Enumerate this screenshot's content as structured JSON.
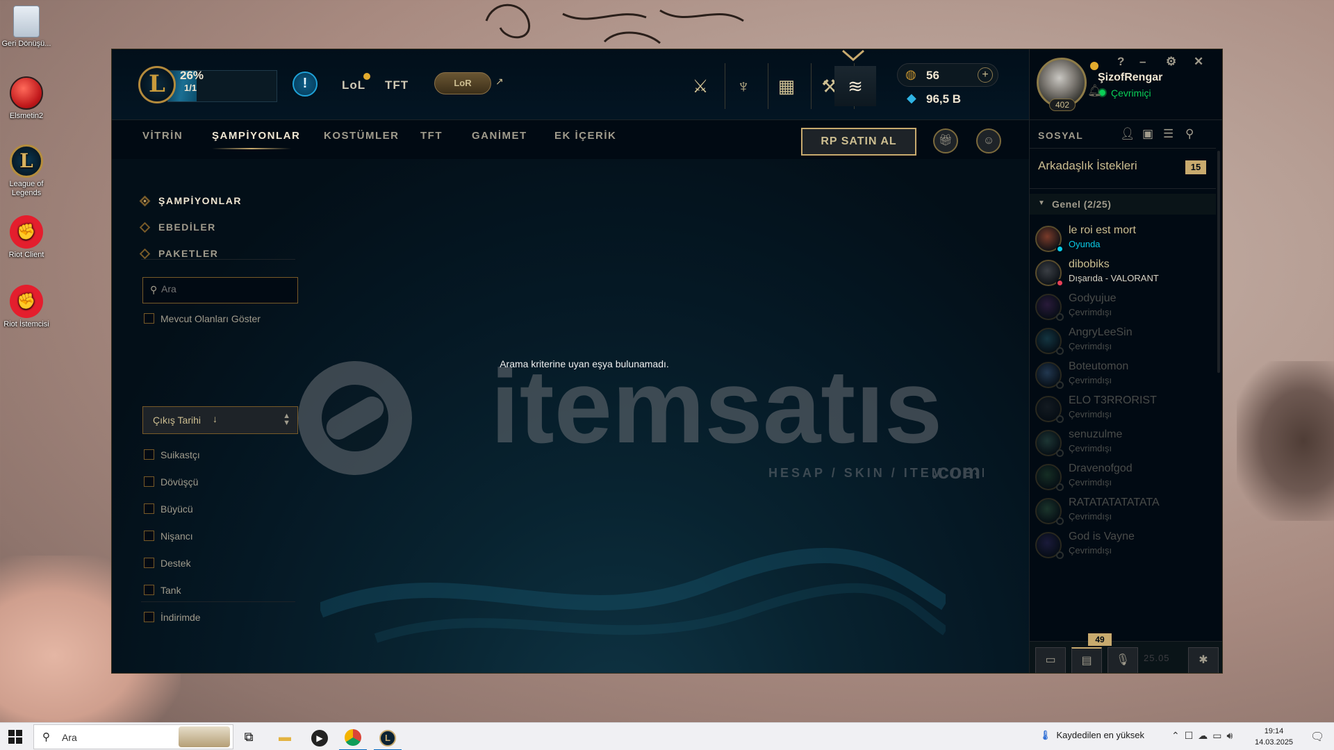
{
  "desktop": {
    "icons": [
      {
        "label": "Geri Dönüşü..."
      },
      {
        "label": "Elsmetin2"
      },
      {
        "label": "League of Legends"
      },
      {
        "label": "Riot Client"
      },
      {
        "label": "Riot İstemcisi"
      }
    ]
  },
  "client": {
    "play": {
      "percent": "26%",
      "count": "1/1",
      "progress_fraction": 0.26
    },
    "game_tabs": {
      "lol": "LoL",
      "tft": "TFT",
      "lor": "LoR"
    },
    "nav_icons": [
      "champions-icon",
      "missions-icon",
      "collection-icon",
      "loot-icon",
      "store-icon"
    ],
    "currency": {
      "rp": "56",
      "be": "96,5 B"
    },
    "profile": {
      "name": "ŞizofRengar",
      "status": "Çevrimiçi",
      "level": "402"
    },
    "window_controls": {
      "help": "?",
      "minimize": "–",
      "settings": "⚙",
      "close": "✕"
    },
    "store_tabs": [
      "VİTRİN",
      "ŞAMPİYONLAR",
      "KOSTÜMLER",
      "TFT",
      "GANİMET",
      "EK İÇERİK"
    ],
    "active_store_tab": "ŞAMPİYONLAR",
    "rp_button": "RP SATIN AL",
    "sidebar": {
      "categories": [
        "ŞAMPİYONLAR",
        "EBEDİLER",
        "PAKETLER"
      ],
      "search_placeholder": "Ara",
      "show_owned": "Mevcut Olanları Göster",
      "sort_label": "Çıkış Tarihi",
      "sort_arrow": "↓",
      "roles": [
        "Suikastçı",
        "Dövüşçü",
        "Büyücü",
        "Nişancı",
        "Destek",
        "Tank"
      ],
      "on_sale": "İndirimde"
    },
    "empty_message": "Arama kriterine uyan eşya bulunamadı.",
    "watermark": {
      "brand": "itemsatıs",
      "tagline": "HESAP / SKIN / ITEM / E-PIN",
      "suffix": ".com"
    }
  },
  "social": {
    "title": "SOSYAL",
    "friend_requests": {
      "label": "Arkadaşlık İstekleri",
      "count": "15"
    },
    "group": {
      "label": "Genel (2/25)"
    },
    "friends": [
      {
        "name": "le roi est mort",
        "status": "Oyunda",
        "state": "ingame"
      },
      {
        "name": "dibobiks",
        "status": "Dışarıda - VALORANT",
        "state": "away"
      },
      {
        "name": "Godyujue",
        "status": "Çevrimdışı",
        "state": "offline"
      },
      {
        "name": "AngryLeeSin",
        "status": "Çevrimdışı",
        "state": "offline"
      },
      {
        "name": "Boteutomon",
        "status": "Çevrimdışı",
        "state": "offline"
      },
      {
        "name": "ELO T3RRORIST",
        "status": "Çevrimdışı",
        "state": "offline"
      },
      {
        "name": "senuzulme",
        "status": "Çevrimdışı",
        "state": "offline"
      },
      {
        "name": "Dravenofgod",
        "status": "Çevrimdışı",
        "state": "offline"
      },
      {
        "name": "RATATATATATATA",
        "status": "Çevrimdışı",
        "state": "offline"
      },
      {
        "name": "God is Vayne",
        "status": "Çevrimdışı",
        "state": "offline"
      }
    ],
    "footer": {
      "badge": "49",
      "patch": "25.05"
    }
  },
  "taskbar": {
    "search_placeholder": "Ara",
    "tray_status": "Kaydedilen en yüksek",
    "time": "19:14",
    "date": "14.03.2025"
  },
  "colors": {
    "gold": "#c8aa6e",
    "gold_text": "#cdbe91",
    "client_bg": "#010a13",
    "online": "#0acf57",
    "ingame": "#0acbe6",
    "away": "#e84057"
  }
}
